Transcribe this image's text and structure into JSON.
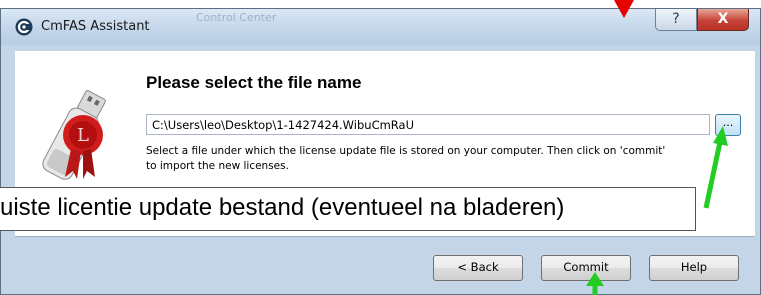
{
  "window": {
    "title": "CmFAS Assistant",
    "background_title": "Control Center",
    "help_button_label": "?",
    "close_button_label": "X"
  },
  "page": {
    "heading": "Please select the file name",
    "file_path": "C:\\Users\\leo\\Desktop\\1-1427424.WibuCmRaU",
    "browse_label": "...",
    "description_line1": "Select a file under which the license update file is stored on your computer. Then click on 'commit'",
    "description_line2": "to import the new licenses."
  },
  "annotation": {
    "callout_text": "uiste licentie update bestand (eventueel na bladeren)"
  },
  "buttons": {
    "back": "< Back",
    "commit": "Commit",
    "help": "Help"
  },
  "colors": {
    "marker_red": "#e60000",
    "arrow_green": "#22cc22",
    "close_red": "#c7443a"
  },
  "icons": {
    "app": "cmfas-app-icon",
    "wizard": "usb-dongle-license-icon"
  }
}
